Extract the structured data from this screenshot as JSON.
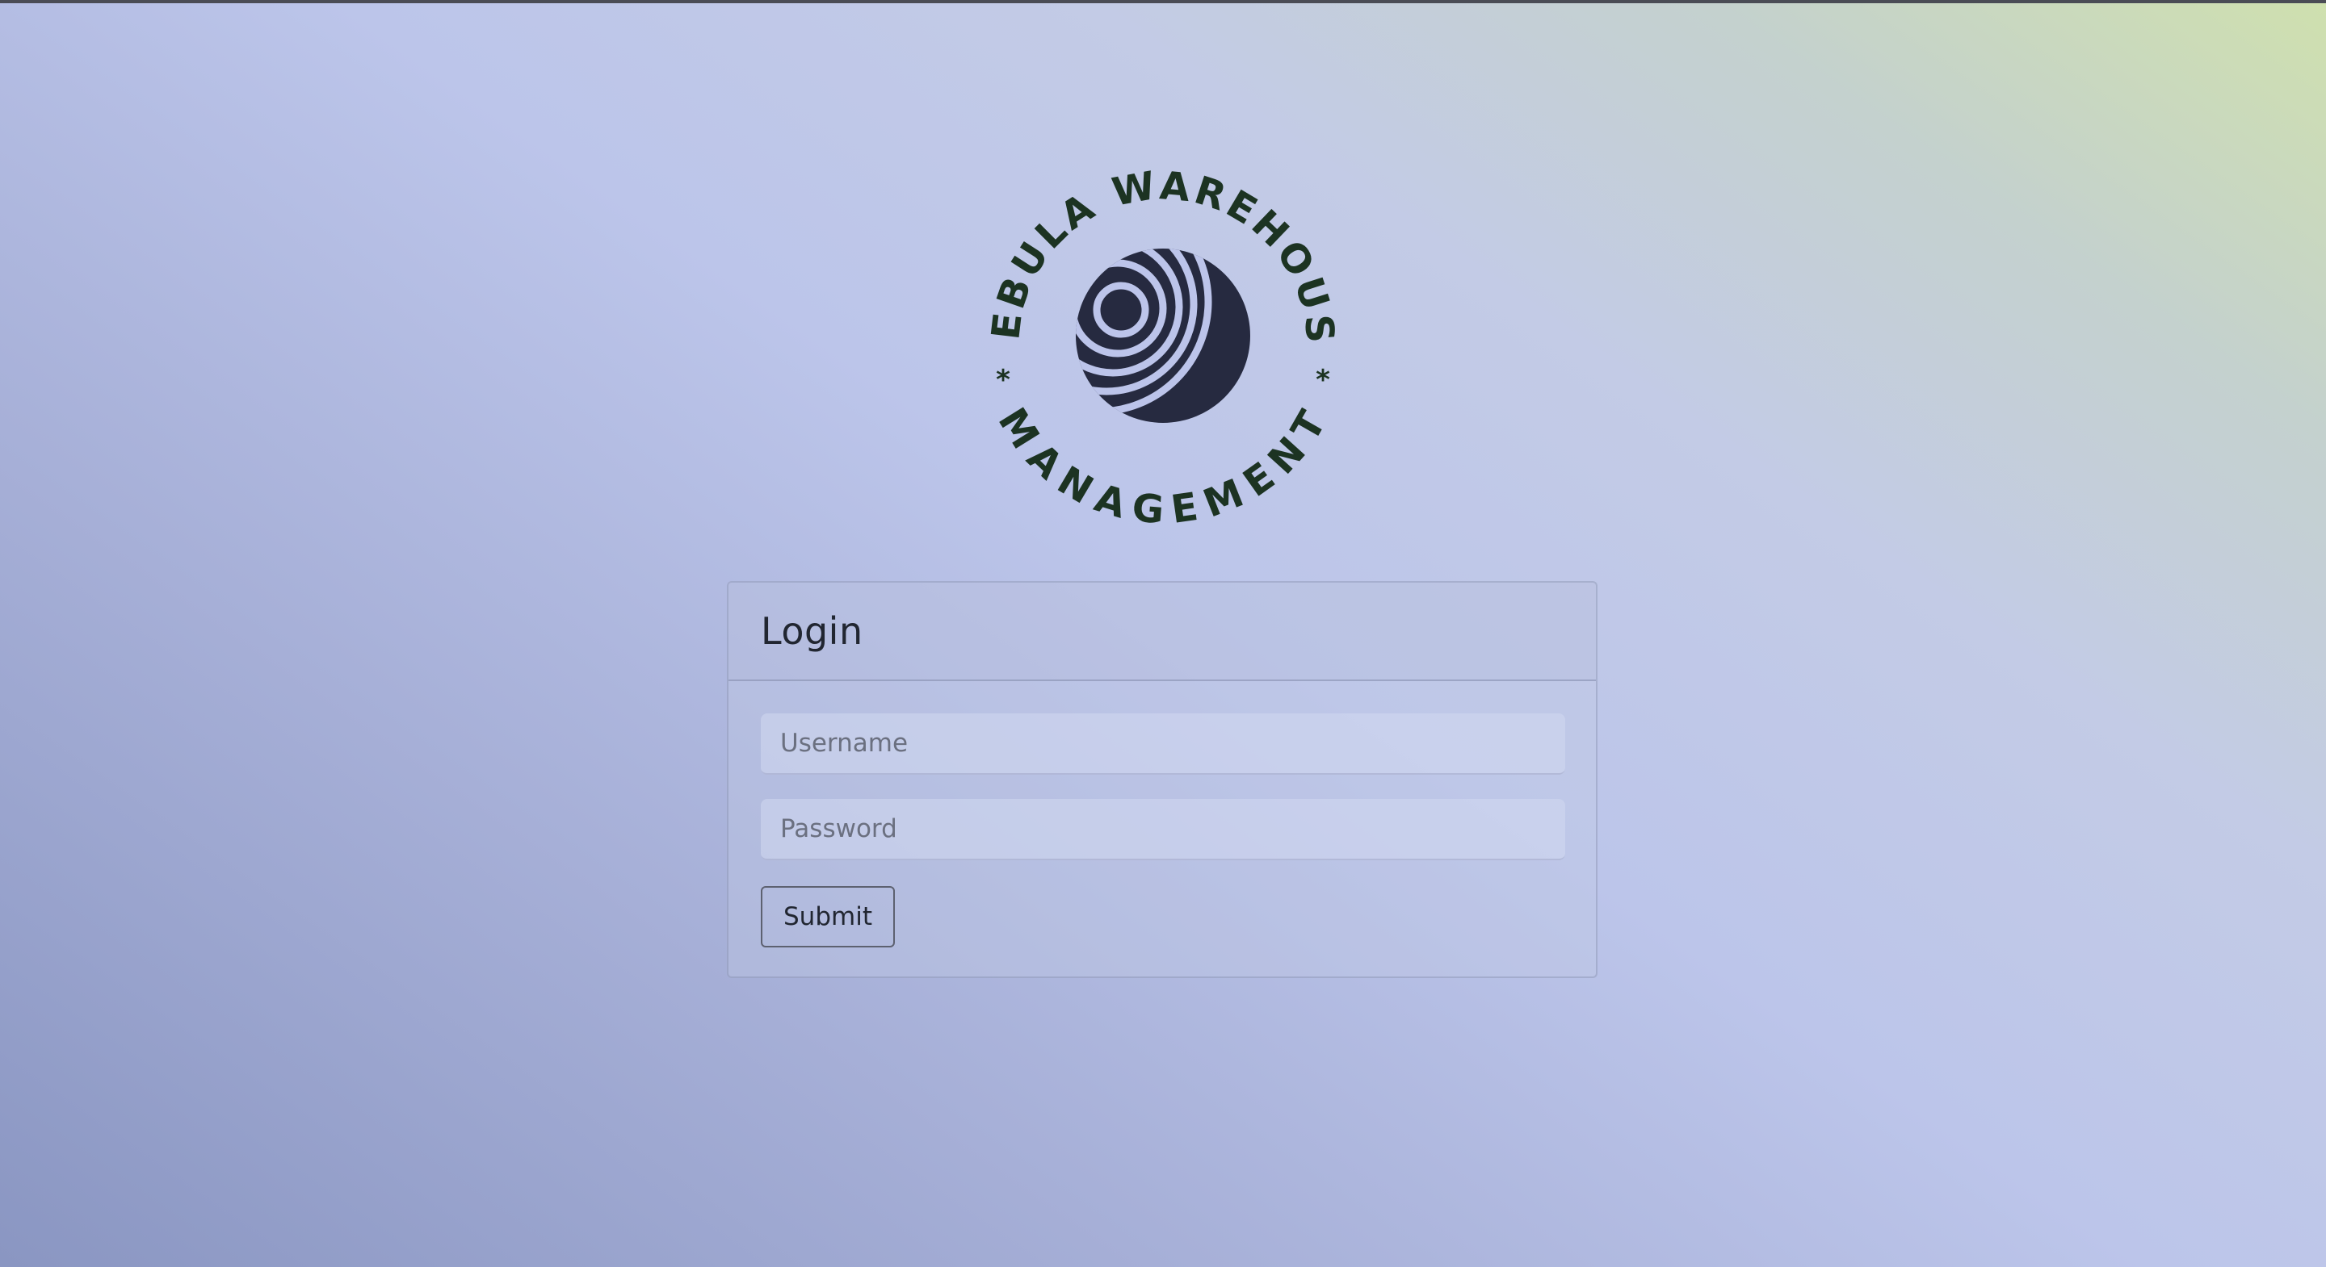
{
  "logo": {
    "top_text": "NEBULA WAREHOUSE",
    "bottom_text": "MANAGEMENT",
    "separator": "*",
    "icon": "striped-sphere-icon"
  },
  "login": {
    "title": "Login",
    "username": {
      "placeholder": "Username",
      "value": ""
    },
    "password": {
      "placeholder": "Password",
      "value": ""
    },
    "submit_label": "Submit"
  },
  "colors": {
    "logo_text": "#1c3322",
    "sphere": "#262a40",
    "sphere_stripes": "#bcc4ea",
    "top_line": "#4a4c55"
  }
}
